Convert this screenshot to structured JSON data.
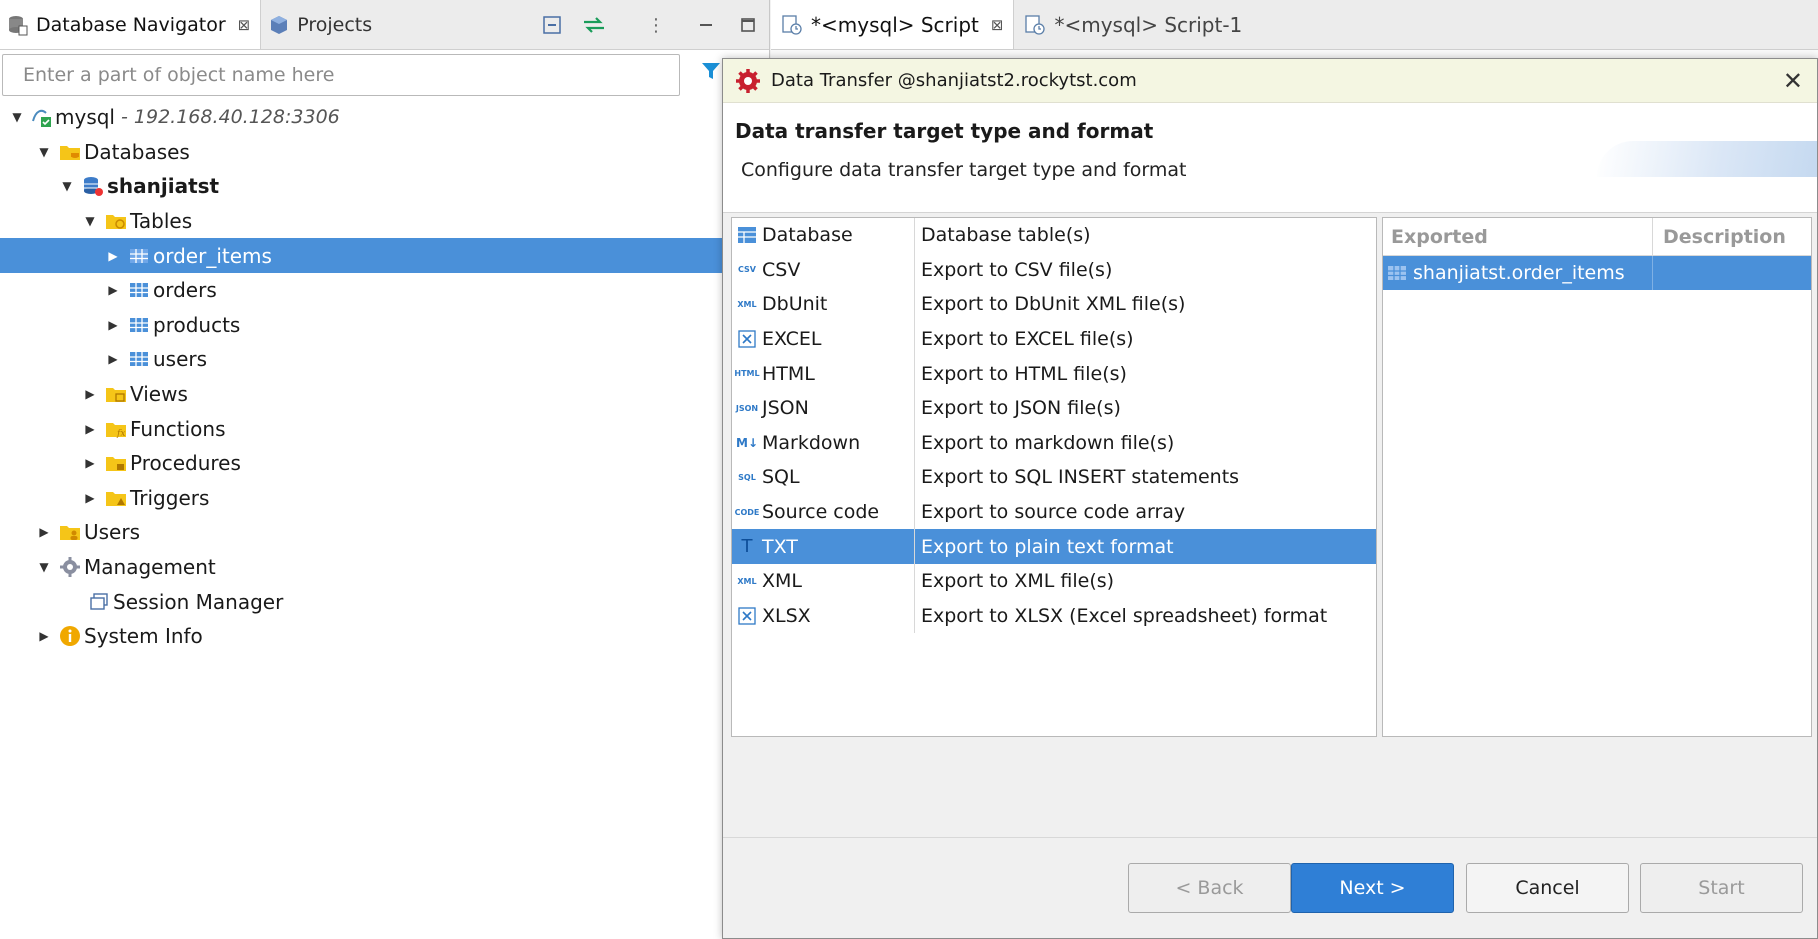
{
  "navigator": {
    "tabs": [
      {
        "label": "Database Navigator"
      },
      {
        "label": "Projects"
      }
    ],
    "search_placeholder": "Enter a part of object name here",
    "tree": {
      "connection": {
        "label": "mysql",
        "sub": "- 192.168.40.128:3306"
      },
      "databases": "Databases",
      "schema": "shanjiatst",
      "tables": "Tables",
      "table_items": [
        "order_items",
        "orders",
        "products",
        "users"
      ],
      "views": "Views",
      "functions": "Functions",
      "procedures": "Procedures",
      "triggers": "Triggers",
      "users": "Users",
      "management": "Management",
      "session_manager": "Session Manager",
      "system_info": "System Info"
    }
  },
  "editor": {
    "tabs": [
      {
        "label": "*<mysql> Script"
      },
      {
        "label": "*<mysql> Script-1"
      }
    ]
  },
  "dialog": {
    "title": "Data Transfer @shanjiatst2.rockytst.com",
    "heading": "Data transfer target type and format",
    "subheading": "Configure data transfer target type and format",
    "formats": [
      {
        "name": "Database",
        "desc": "Database table(s)",
        "icon": "database-table-icon"
      },
      {
        "name": "CSV",
        "desc": "Export to CSV file(s)",
        "icon": "csv-icon"
      },
      {
        "name": "DbUnit",
        "desc": "Export to DbUnit XML file(s)",
        "icon": "xml-icon"
      },
      {
        "name": "EXCEL",
        "desc": "Export to EXCEL file(s)",
        "icon": "excel-icon"
      },
      {
        "name": "HTML",
        "desc": "Export to HTML file(s)",
        "icon": "html-icon"
      },
      {
        "name": "JSON",
        "desc": "Export to JSON file(s)",
        "icon": "json-icon"
      },
      {
        "name": "Markdown",
        "desc": "Export to markdown file(s)",
        "icon": "markdown-icon"
      },
      {
        "name": "SQL",
        "desc": "Export to SQL INSERT statements",
        "icon": "sql-icon"
      },
      {
        "name": "Source code",
        "desc": "Export to source code array",
        "icon": "code-icon"
      },
      {
        "name": "TXT",
        "desc": "Export to plain text format",
        "icon": "txt-icon"
      },
      {
        "name": "XML",
        "desc": "Export to XML file(s)",
        "icon": "xml-icon"
      },
      {
        "name": "XLSX",
        "desc": "Export to XLSX (Excel spreadsheet) format",
        "icon": "excel-icon"
      }
    ],
    "selected_format": "TXT",
    "export_table": {
      "headers": [
        "Exported",
        "Description"
      ],
      "rows": [
        {
          "exported": "shanjiatst.order_items",
          "description": ""
        }
      ]
    },
    "buttons": {
      "back": "< Back",
      "next": "Next >",
      "cancel": "Cancel",
      "start": "Start"
    }
  },
  "colors": {
    "selection": "#4a90d9",
    "primary_button": "#2f7fd6",
    "folder": "#f5c518",
    "title_bar": "#f4f6e2"
  }
}
